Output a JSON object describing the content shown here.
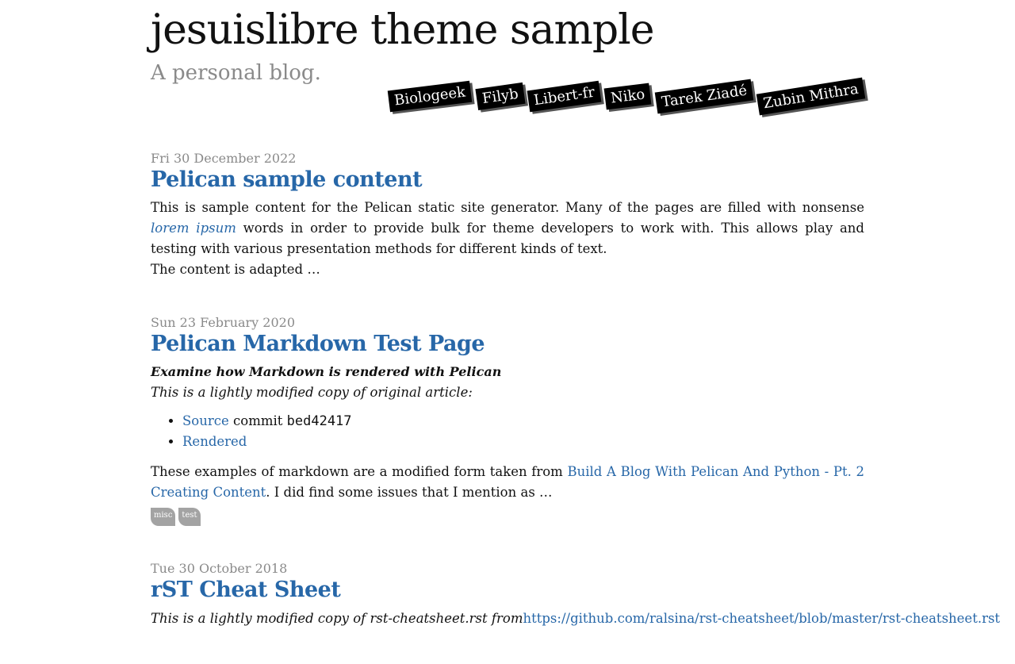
{
  "site": {
    "title": "jesuislibre theme sample",
    "subtitle": "A personal blog."
  },
  "nav": [
    {
      "label": "Biologeek"
    },
    {
      "label": "Filyb"
    },
    {
      "label": "Libert-fr"
    },
    {
      "label": "Niko"
    },
    {
      "label": "Tarek Ziadé"
    },
    {
      "label": "Zubin Mithra"
    }
  ],
  "posts": [
    {
      "date": "Fri 30 December 2022",
      "title": "Pelican sample content",
      "summary_part1": "This is sample content for the Pelican static site generator. Many of the pages are filled with nonsense",
      "summary_link": "lorem ipsum",
      "summary_part2": "words in order to provide bulk for theme developers to work with. This allows play and testing with various presentation methods for different kinds of text.",
      "summary_part3": "The content is adapted …"
    },
    {
      "date": "Sun 23 February 2020",
      "title": "Pelican Markdown Test Page",
      "lead": "Examine how Markdown is rendered with Pelican",
      "copy_note": "This is a lightly modified copy of original article:",
      "list": {
        "source_link": "Source",
        "commit_text": "commit",
        "commit_hash": "bed42417",
        "rendered_link": "Rendered"
      },
      "body_part1": "These examples of markdown are a modified form taken from",
      "body_link": "Build A Blog With Pelican And Python - Pt. 2 Creating Content",
      "body_part2": ". I did find some issues that I mention as …",
      "tags": [
        "misc",
        "test"
      ]
    },
    {
      "date": "Tue 30 October 2018",
      "title": "rST Cheat Sheet",
      "note_part1": "This is a lightly modified copy of rst-cheatsheet.rst from",
      "note_link": "https://github.com/ralsina/rst-cheatsheet/blob/master/rst-cheatsheet.rst"
    }
  ],
  "colors": {
    "link": "#2767a8",
    "muted": "#8a8a8a",
    "nav_bg": "#000000",
    "tag_bg": "#a3a3a3"
  }
}
